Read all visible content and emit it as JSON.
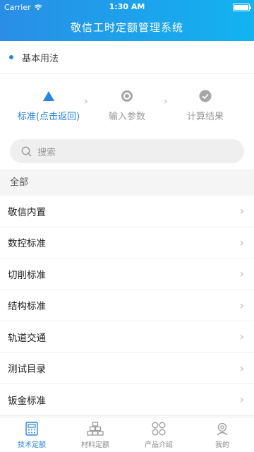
{
  "status": {
    "carrier": "Carrier",
    "time": "1:30 AM"
  },
  "app": {
    "title": "敬信工时定额管理系统"
  },
  "section": {
    "label": "基本用法"
  },
  "steps": [
    {
      "label": "标准(点击返回)",
      "state": "active"
    },
    {
      "label": "输入参数",
      "state": "pending"
    },
    {
      "label": "计算结果",
      "state": "done"
    }
  ],
  "search": {
    "placeholder": "搜索"
  },
  "list_header": "全部",
  "items": [
    "敬信内置",
    "数控标准",
    "切削标准",
    "结构标准",
    "轨道交通",
    "测试目录",
    "钣金标准"
  ],
  "tabs": [
    {
      "label": "技术定额",
      "icon": "calculator-icon"
    },
    {
      "label": "材料定额",
      "icon": "stack-icon"
    },
    {
      "label": "产品介绍",
      "icon": "grid-icon"
    },
    {
      "label": "我的",
      "icon": "user-icon"
    }
  ],
  "colors": {
    "accent": "#2a85e0",
    "header_start": "#2a8ee6",
    "header_end": "#12b3f0"
  }
}
